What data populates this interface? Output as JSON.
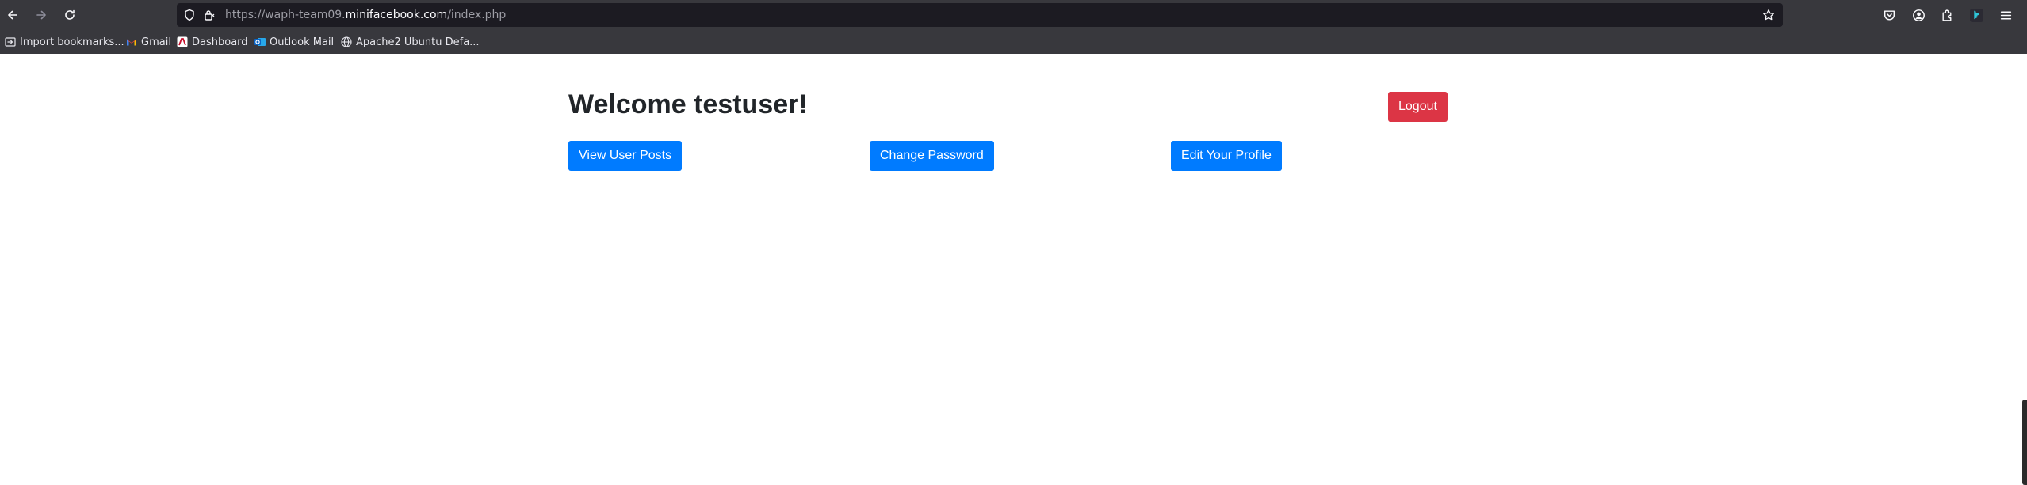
{
  "browser": {
    "url": {
      "scheme_prefix": "https://waph-team09.",
      "domain": "minifacebook.com",
      "path": "/index.php"
    },
    "bookmarks": [
      {
        "label": "Import bookmarks...",
        "icon": "import-icon"
      },
      {
        "label": "Gmail",
        "icon": "gmail-icon"
      },
      {
        "label": "Dashboard",
        "icon": "dashboard-icon"
      },
      {
        "label": "Outlook Mail",
        "icon": "outlook-icon"
      },
      {
        "label": "Apache2 Ubuntu Defa...",
        "icon": "globe-icon"
      }
    ],
    "icons": {
      "back": "back-arrow-icon",
      "forward": "forward-arrow-icon",
      "reload": "reload-icon",
      "shield": "shield-icon",
      "lock": "lock-icon",
      "star": "bookmark-star-icon",
      "pocket": "pocket-icon",
      "account": "account-icon",
      "extensions": "extensions-icon",
      "profile_ext": "bing-icon",
      "menu": "hamburger-menu-icon"
    }
  },
  "page": {
    "heading": "Welcome testuser!",
    "logout_label": "Logout",
    "actions": {
      "view_posts": "View User Posts",
      "change_password": "Change Password",
      "edit_profile": "Edit Your Profile"
    }
  },
  "colors": {
    "primary": "#007bff",
    "danger": "#dc3545",
    "chrome_bg": "#38383d",
    "urlbar_bg": "#1c1b22"
  }
}
